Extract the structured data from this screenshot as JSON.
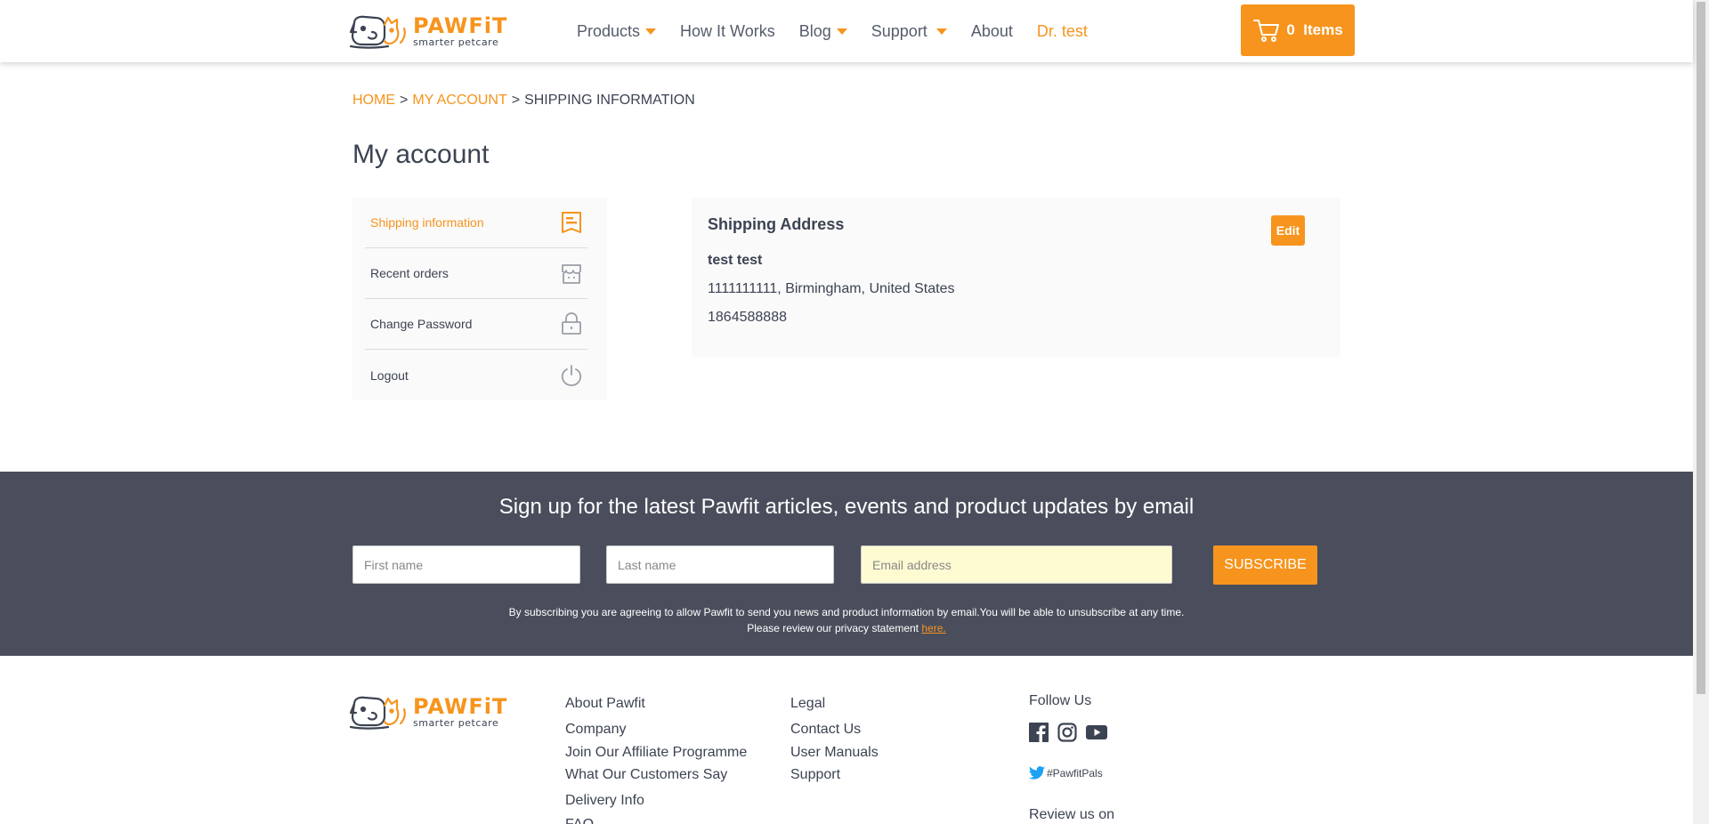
{
  "header": {
    "brand": {
      "name": "PAWFiT",
      "tagline": "smarter petcare"
    },
    "nav": [
      {
        "label": "Products",
        "has_dropdown": true
      },
      {
        "label": "How It Works",
        "has_dropdown": false
      },
      {
        "label": "Blog",
        "has_dropdown": true
      },
      {
        "label": "Support",
        "has_dropdown": true
      },
      {
        "label": "About",
        "has_dropdown": false
      },
      {
        "label": "Dr. test",
        "has_dropdown": false
      }
    ],
    "cart": {
      "label": "0  Items",
      "icon": "cart-icon"
    }
  },
  "breadcrumb": {
    "home": "HOME",
    "sep": ">",
    "account": "MY ACCOUNT",
    "current": "SHIPPING INFORMATION"
  },
  "page": {
    "title": "My account"
  },
  "sidebar": {
    "items": [
      {
        "label": "Shipping information",
        "icon": "shipping-doc-icon",
        "active": true
      },
      {
        "label": "Recent orders",
        "icon": "store-icon",
        "active": false
      },
      {
        "label": "Change Password",
        "icon": "lock-icon",
        "active": false
      },
      {
        "label": "Logout",
        "icon": "power-icon",
        "active": false
      }
    ]
  },
  "shipping": {
    "title": "Shipping Address",
    "edit_label": "Edit",
    "name": "test test",
    "address": "1111111111, Birmingham, United States",
    "phone": "1864588888"
  },
  "newsletter": {
    "title": "Sign up for the latest Pawfit articles, events and product updates by email",
    "first_name_placeholder": "First name",
    "last_name_placeholder": "Last name",
    "email_placeholder": "Email address",
    "subscribe_label": "SUBSCRIBE",
    "disclaimer_line1": "By subscribing you are agreeing to allow Pawfit to send you news and product information by email.You will be able to unsubscribe at any time.",
    "disclaimer_line2": "Please review our privacy statement",
    "disclaimer_link": "here."
  },
  "footer": {
    "col1": [
      "About Pawfit",
      "Company",
      "Join Our Affiliate Programme",
      "What Our Customers Say",
      "Delivery Info",
      "FAQ"
    ],
    "col2": [
      "Legal",
      "Contact Us",
      "User Manuals",
      "Support"
    ],
    "follow_title": "Follow Us",
    "social": [
      "facebook-icon",
      "instagram-icon",
      "youtube-icon"
    ],
    "hashtag": "#PawfitPals",
    "review": "Review us on"
  },
  "colors": {
    "accent": "#f7941d",
    "text": "#3c4352",
    "newsletter_bg": "#4a4e5c",
    "panel_bg": "#fafafa"
  }
}
